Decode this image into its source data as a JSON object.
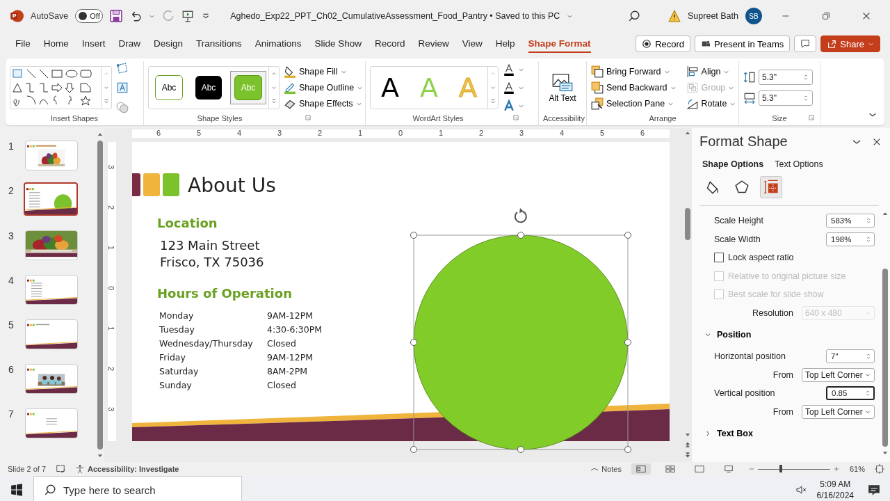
{
  "title_bar": {
    "autosave_label": "AutoSave",
    "autosave": {
      "on": false,
      "label": "Off"
    },
    "document_title": "Aghedo_Exp22_PPT_Ch02_CumulativeAssessment_Food_Pantry • Saved to this PC",
    "user_name": "Supreet Bath",
    "avatar_initials": "SB"
  },
  "ribbon_tabs": [
    {
      "label": "File",
      "selected": false
    },
    {
      "label": "Home",
      "selected": false
    },
    {
      "label": "Insert",
      "selected": false
    },
    {
      "label": "Draw",
      "selected": false
    },
    {
      "label": "Design",
      "selected": false
    },
    {
      "label": "Transitions",
      "selected": false
    },
    {
      "label": "Animations",
      "selected": false
    },
    {
      "label": "Slide Show",
      "selected": false
    },
    {
      "label": "Record",
      "selected": false
    },
    {
      "label": "Review",
      "selected": false
    },
    {
      "label": "View",
      "selected": false
    },
    {
      "label": "Help",
      "selected": false
    },
    {
      "label": "Shape Format",
      "selected": true
    }
  ],
  "ribbon_actions": [
    {
      "kind": "record",
      "label": "Record"
    },
    {
      "kind": "teams",
      "label": "Present in Teams"
    },
    {
      "kind": "comment"
    },
    {
      "kind": "share",
      "label": "Share"
    }
  ],
  "ribbon": {
    "insert_shapes": {
      "label": "Insert Shapes"
    },
    "shape_styles": {
      "label": "Shape Styles",
      "swatches": [
        {
          "text": "Abc",
          "kind": "outline",
          "selected": false
        },
        {
          "text": "Abc",
          "kind": "dark",
          "selected": false
        },
        {
          "text": "Abc",
          "kind": "green",
          "selected": true
        }
      ],
      "commands": [
        {
          "kind": "fill",
          "label": "Shape Fill"
        },
        {
          "kind": "outline",
          "label": "Shape Outline"
        },
        {
          "kind": "effects",
          "label": "Shape Effects"
        }
      ]
    },
    "wordart_styles": {
      "label": "WordArt Styles",
      "letters": [
        {
          "text": "A",
          "kind": "black"
        },
        {
          "text": "A",
          "kind": "green"
        },
        {
          "text": "A",
          "kind": "gold"
        }
      ]
    },
    "accessibility": {
      "label": "Accessibility",
      "button": "Alt Text"
    },
    "arrange": {
      "label": "Arrange",
      "commands": [
        {
          "kind": "forward",
          "label": "Bring Forward",
          "disabled": false
        },
        {
          "kind": "backward",
          "label": "Send Backward",
          "disabled": false
        },
        {
          "kind": "pane",
          "label": "Selection Pane",
          "disabled": false
        },
        {
          "kind": "align",
          "label": "Align",
          "disabled": false
        },
        {
          "kind": "group",
          "label": "Group",
          "disabled": true
        },
        {
          "kind": "rotate",
          "label": "Rotate",
          "disabled": false
        }
      ]
    },
    "size": {
      "label": "Size",
      "height": "5.3\"",
      "width": "5.3\""
    }
  },
  "thumbnails": [
    {
      "number": "1",
      "kind": "title-photo",
      "selected": false
    },
    {
      "number": "2",
      "kind": "circle",
      "selected": true
    },
    {
      "number": "3",
      "kind": "photo-banner",
      "selected": false
    },
    {
      "number": "4",
      "kind": "bullets",
      "selected": false
    },
    {
      "number": "5",
      "kind": "title-only",
      "selected": false
    },
    {
      "number": "6",
      "selected": false
    },
    {
      "number": "7",
      "kind": "contact",
      "selected": false
    }
  ],
  "ruler": {
    "horizontal": [
      "6",
      "5",
      "4",
      "3",
      "2",
      "1",
      "0",
      "1",
      "2",
      "3",
      "4",
      "5",
      "6"
    ],
    "vertical": [
      "3",
      "2",
      "1",
      "0",
      "1",
      "2",
      "3"
    ]
  },
  "slide": {
    "title": "About Us",
    "location_heading": "Location",
    "address": [
      "123 Main Street",
      "Frisco, TX 75036"
    ],
    "hours_heading": "Hours of Operation",
    "hours": [
      {
        "day": "Monday",
        "time": "9AM-12PM"
      },
      {
        "day": "Tuesday",
        "time": "4:30-6:30PM"
      },
      {
        "day": "Wednesday/Thursday",
        "time": "Closed"
      },
      {
        "day": "Friday",
        "time": "9AM-12PM"
      },
      {
        "day": "Saturday",
        "time": "8AM-2PM"
      },
      {
        "day": "Sunday",
        "time": "Closed"
      }
    ]
  },
  "format_pane": {
    "title": "Format Shape",
    "tabs": [
      {
        "label": "Shape Options",
        "selected": true
      },
      {
        "label": "Text Options",
        "selected": false
      }
    ],
    "icon_tabs": [
      {
        "kind": "fill",
        "selected": false
      },
      {
        "kind": "effects",
        "selected": false
      },
      {
        "kind": "size",
        "selected": true
      }
    ],
    "rows": [
      {
        "kind": "spin",
        "label": "Scale Height",
        "value": "583%",
        "focused": false
      },
      {
        "kind": "spin",
        "label": "Scale Width",
        "value": "198%",
        "focused": false
      },
      {
        "kind": "checkbox",
        "label": "Lock aspect ratio",
        "checked": false,
        "disabled": false
      },
      {
        "kind": "checkbox",
        "label": "Relative to original picture size",
        "checked": false,
        "disabled": true
      },
      {
        "kind": "checkbox",
        "label": "Best scale for slide show",
        "checked": false,
        "disabled": true
      },
      {
        "kind": "dropdown",
        "label": "Resolution",
        "value": "640 x 480",
        "disabled": true
      },
      {
        "kind": "section",
        "label": "Position",
        "expanded": true
      },
      {
        "kind": "spin",
        "label": "Horizontal position",
        "value": "7\"",
        "focused": false
      },
      {
        "kind": "dropdown",
        "label": "From",
        "value": "Top Left Corner",
        "disabled": false
      },
      {
        "kind": "spin",
        "label": "Vertical position",
        "value": "0.85",
        "focused": true
      },
      {
        "kind": "dropdown",
        "label": "From",
        "value": "Top Left Corner",
        "disabled": false
      },
      {
        "kind": "section",
        "label": "Text Box",
        "expanded": false
      }
    ]
  },
  "status_bar": {
    "slide_indicator": "Slide 2 of 7",
    "accessibility": "Accessibility: Investigate",
    "notes": "Notes",
    "views": [
      {
        "kind": "normal",
        "selected": true
      },
      {
        "kind": "sorter",
        "selected": false
      },
      {
        "kind": "reading",
        "selected": false
      },
      {
        "kind": "slideshow",
        "selected": false
      }
    ],
    "zoom": {
      "level": 0.32,
      "reading": "61%"
    }
  },
  "taskbar": {
    "search_placeholder": "Type here to search",
    "time": "5:09 AM",
    "date": "6/16/2024"
  }
}
